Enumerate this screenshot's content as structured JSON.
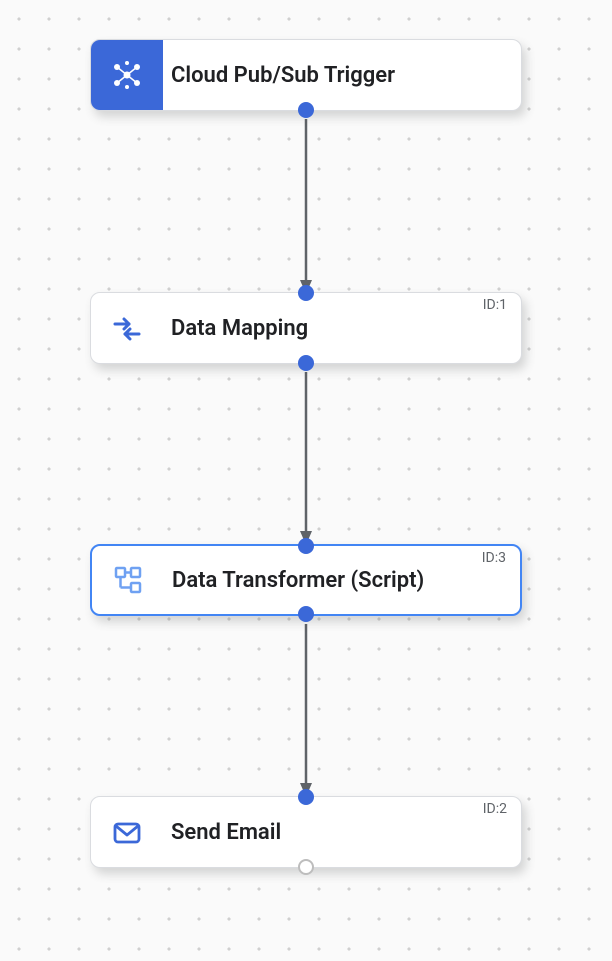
{
  "canvas": {
    "accent": "#3b68d8",
    "dot_color": "#d0d0d0"
  },
  "nodes": {
    "trigger": {
      "label": "Cloud Pub/Sub Trigger",
      "icon": "pubsub-icon"
    },
    "mapping": {
      "label": "Data Mapping",
      "id_label": "ID:1",
      "icon": "data-mapping-icon"
    },
    "transformer": {
      "label": "Data Transformer (Script)",
      "id_label": "ID:3",
      "icon": "data-transformer-icon",
      "selected": true
    },
    "sendemail": {
      "label": "Send Email",
      "id_label": "ID:2",
      "icon": "mail-icon"
    }
  },
  "edges": [
    {
      "from": "trigger",
      "to": "mapping"
    },
    {
      "from": "mapping",
      "to": "transformer"
    },
    {
      "from": "transformer",
      "to": "sendemail"
    }
  ]
}
